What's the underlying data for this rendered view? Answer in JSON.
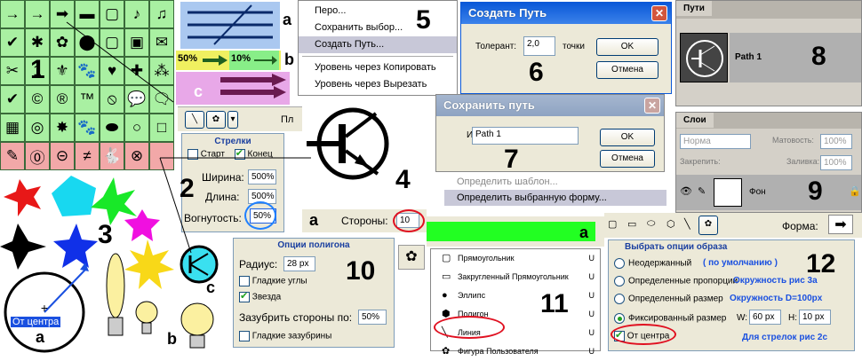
{
  "shapes_grid": {
    "green": "#a9f0a2",
    "pink": "#f2a8a8",
    "icons": [
      "arrow-icon",
      "arrow-icon",
      "arrow-icon",
      "banner-icon",
      "frame-icon",
      "note-icon",
      "note-icon",
      "check-icon",
      "star-icon",
      "leaf-icon",
      "blob-icon",
      "frame-icon",
      "frame-icon",
      "envelope-icon",
      "scissors-icon",
      "number-label",
      "fleur-icon",
      "dog-icon",
      "heart-icon",
      "puzzle-icon",
      "grass-icon",
      "check-icon",
      "copyright-icon",
      "registered-icon",
      "trademark-icon",
      "no-sign-icon",
      "speech-icon",
      "speech-icon",
      "grid-icon",
      "target-icon",
      "burst-icon",
      "paw-icon",
      "blob-icon",
      "circle-icon",
      "square-icon",
      "pencil-icon",
      "zero-icon",
      "minus-circle-icon",
      "not-equal-icon",
      "rabbit-icon",
      "transistor-icon",
      "blank"
    ],
    "glyphs": [
      "→",
      "→",
      "➡",
      "▬",
      "▢",
      "♪",
      "♫",
      "✔",
      "✱",
      "✿",
      "⬤",
      "▢",
      "▣",
      "✉",
      "✂",
      "1",
      "⚜",
      "🐾",
      "♥",
      "✚",
      "⁂",
      "✔",
      "©",
      "®",
      "™",
      "⦸",
      "💬",
      "🗨",
      "▦",
      "◎",
      "✸",
      "🐾",
      "⬬",
      "○",
      "□",
      "✎",
      "⓪",
      "⊝",
      "≠",
      "🐇",
      "⊗",
      ""
    ],
    "label_1": "1"
  },
  "arrows_panel": {
    "label_a": "a",
    "label_b": "b",
    "label_c": "c",
    "pct_50": "50%",
    "pct_10": "10%"
  },
  "arrowheads_panel": {
    "title": "Стрелки",
    "start_label": "Старт",
    "end_label": "Конец",
    "width_label": "Ширина:",
    "width_value": "500%",
    "length_label": "Длина:",
    "length_value": "500%",
    "concavity_label": "Вогнутость:",
    "concavity_value": "50%",
    "pl_label": "Пл",
    "number": "2"
  },
  "shapes3": {
    "number": "3",
    "from_center": "От центра",
    "label_a": "a",
    "label_b": "b",
    "label_c": "c"
  },
  "transistor": {
    "number": "4"
  },
  "context_menu": {
    "items": [
      "Перо...",
      "Сохранить выбор...",
      "Создать Путь...",
      "Уровень через Копировать",
      "Уровень через Вырезать"
    ],
    "highlight_index": 2,
    "number": "5"
  },
  "make_path_dialog": {
    "title": "Создать Путь",
    "tolerance_label": "Толерант:",
    "tolerance_value": "2,0",
    "units": "точки",
    "ok": "OK",
    "cancel": "Отмена",
    "number": "6"
  },
  "save_path_dialog": {
    "title": "Сохранить путь",
    "name_label": "Имя:",
    "name_value": "Path 1",
    "ok": "OK",
    "cancel": "Отмена",
    "number": "7"
  },
  "edit_menu": {
    "items": [
      "Определить шаблон...",
      "Определить выбранную форму..."
    ],
    "highlight_index": 1
  },
  "paths_palette": {
    "tab": "Пути",
    "path_name": "Path 1",
    "number": "8"
  },
  "layers_palette": {
    "tab": "Слои",
    "blend_mode": "Норма",
    "opacity_label": "Матовость:",
    "opacity_value": "100%",
    "lock_label": "Закрепить:",
    "fill_label": "Заливка:",
    "fill_value": "100%",
    "layer_name": "Фон",
    "number": "9"
  },
  "sides_bar": {
    "label_a": "a",
    "sides_label": "Стороны:",
    "sides_value": "10"
  },
  "polygon_options": {
    "title": "Опции полигона",
    "radius_label": "Радиус:",
    "radius_value": "28 px",
    "smooth_corners": "Гладкие углы",
    "star": "Звезда",
    "indent_label": "Зазубрить стороны по:",
    "indent_value": "50%",
    "smooth_indents": "Гладкие зазубрины",
    "number": "10"
  },
  "shape_tools": {
    "items": [
      "Прямоугольник",
      "Закругленный Прямоугольник",
      "Эллипс",
      "Полигон",
      "Линия",
      "Фигура Пользователя"
    ],
    "shortcut": "U",
    "number": "11",
    "label_a": "a"
  },
  "custom_shape_options": {
    "title": "Выбрать опции образа",
    "unconstrained": "Неодержанный",
    "unconstrained_note": "( по умолчанию )",
    "defined_proportions": "Определенные пропорции",
    "note_3a": "Окружность рис 3а",
    "defined_size": "Определенный размер",
    "note_d": "Окружность D=100px",
    "fixed_size": "Фиксированный размер",
    "w_label": "W:",
    "w_value": "60 px",
    "h_label": "H:",
    "h_value": "10 px",
    "from_center": "От центра",
    "note_2c": "Для стрелок рис 2с",
    "number": "12",
    "shape_label": "Форма:"
  }
}
